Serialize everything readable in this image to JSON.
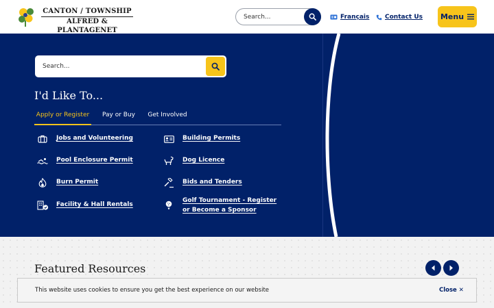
{
  "header": {
    "logo_line1": "CANTON / TOWNSHIP",
    "logo_line2": "ALFRED & PLANTAGENET",
    "search_placeholder": "Search...",
    "language_label": "Français",
    "contact_label": "Contact Us",
    "menu_label": "Menu"
  },
  "hero": {
    "search_placeholder": "Search...",
    "title": "I'd Like To...",
    "tabs": [
      {
        "label": "Apply or Register"
      },
      {
        "label": "Pay or Buy"
      },
      {
        "label": "Get Involved"
      }
    ],
    "links": [
      {
        "label": "Jobs and Volunteering",
        "icon": "briefcase-icon"
      },
      {
        "label": "Building Permits",
        "icon": "id-card-icon"
      },
      {
        "label": "Pool Enclosure Permit",
        "icon": "swimmer-icon"
      },
      {
        "label": "Dog Licence",
        "icon": "dog-icon"
      },
      {
        "label": "Burn Permit",
        "icon": "fire-icon"
      },
      {
        "label": "Bids and Tenders",
        "icon": "gavel-icon"
      },
      {
        "label": "Facility & Hall Rentals",
        "icon": "building-icon"
      },
      {
        "label": "Golf Tournament - Register or Become a Sponsor",
        "icon": "golf-icon"
      }
    ]
  },
  "featured": {
    "title": "Featured Resources"
  },
  "cookie": {
    "message": "This website uses cookies to ensure you get the best experience on our website",
    "close_label": "Close ✕"
  },
  "colors": {
    "navy": "#012169",
    "gold": "#f7c41b"
  }
}
